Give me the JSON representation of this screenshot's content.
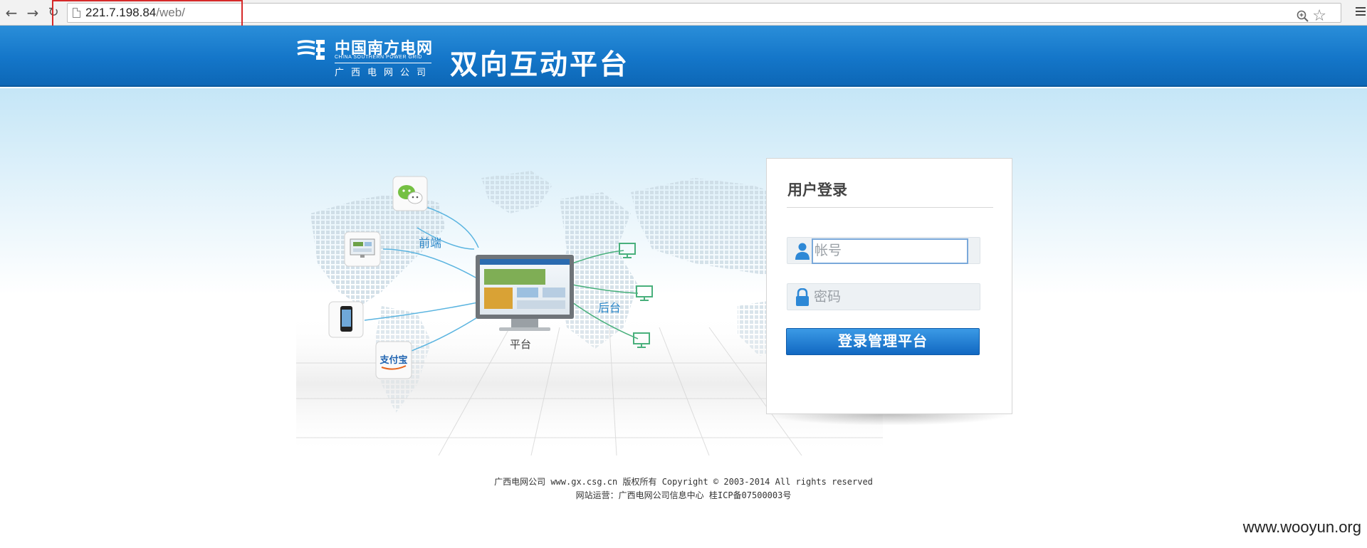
{
  "browser": {
    "url_host": "221.7.198.84",
    "url_path": "/web/",
    "back_icon": "arrow-left",
    "forward_icon": "arrow-right",
    "reload_icon": "reload",
    "zoom_icon": "magnifier-zoom",
    "bookmark_icon": "star-outline",
    "menu_icon": "hamburger",
    "highlight_color": "#d62a2a"
  },
  "header": {
    "logo_cn": "中国南方电网",
    "logo_en": "CHINA SOUTHERN POWER GRID",
    "logo_sub": "广西电网公司",
    "platform_title": "双向互动平台",
    "brand_color": "#1476c9"
  },
  "illustration": {
    "frontend_label": "前端",
    "backend_label": "后台",
    "platform_label": "平台",
    "alipay_label": "支付宝",
    "icons": [
      "wechat-icon",
      "webpage-icon",
      "smartphone-icon",
      "alipay-icon",
      "monitor-platform-icon",
      "monitor-icon",
      "monitor-icon",
      "monitor-icon"
    ]
  },
  "login": {
    "title": "用户登录",
    "account_placeholder": "帐号",
    "account_value": "",
    "password_placeholder": "密码",
    "password_value": "",
    "submit_label": "登录管理平台",
    "button_color": "#1a7ad2"
  },
  "footer": {
    "line1": "广西电网公司 www.gx.csg.cn 版权所有 Copyright © 2003-2014 All rights reserved",
    "line2": "网站运营：广西电网公司信息中心 桂ICP备07500003号"
  },
  "watermark": "www.wooyun.org"
}
